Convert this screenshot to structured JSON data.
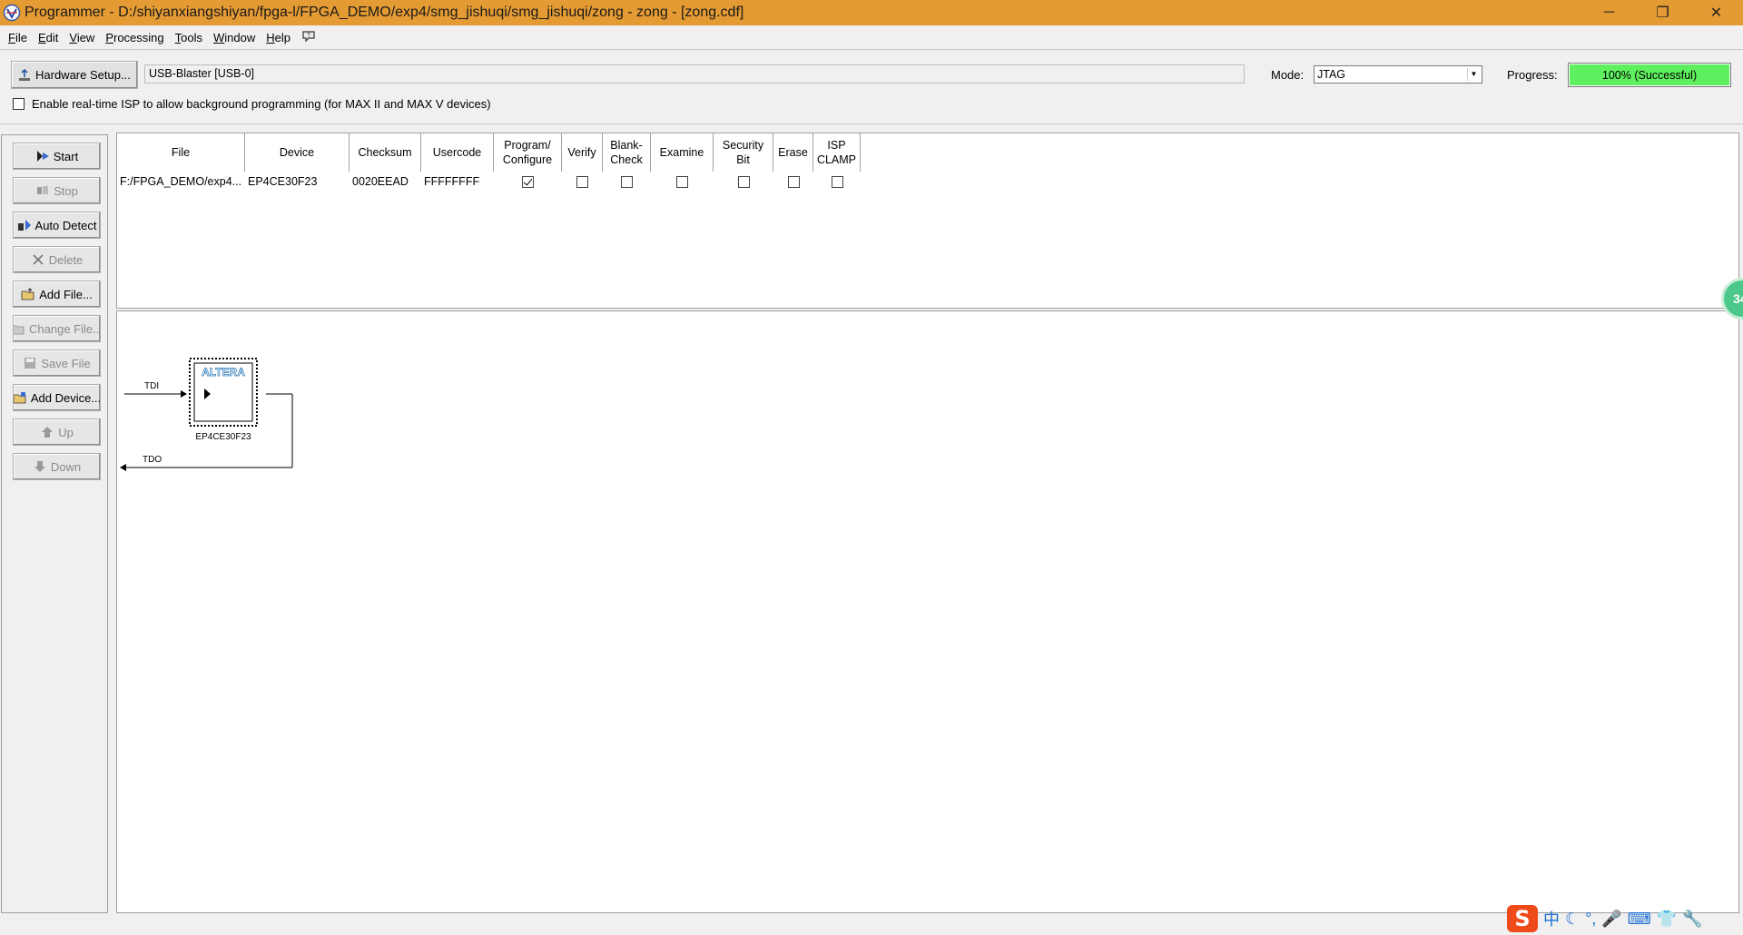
{
  "window": {
    "title": "Programmer - D:/shiyanxiangshiyan/fpga-l/FPGA_DEMO/exp4/smg_jishuqi/smg_jishuqi/zong - zong - [zong.cdf]",
    "minimize": "─",
    "maximize": "❐",
    "close": "✕"
  },
  "menu": [
    {
      "key": "F",
      "rest": "ile"
    },
    {
      "key": "E",
      "rest": "dit"
    },
    {
      "key": "V",
      "rest": "iew"
    },
    {
      "key": "P",
      "rest": "rocessing"
    },
    {
      "key": "T",
      "rest": "ools"
    },
    {
      "key": "W",
      "rest": "indow"
    },
    {
      "key": "H",
      "rest": "elp"
    }
  ],
  "toolbar": {
    "hardware_setup_label": "Hardware Setup...",
    "hardware_value": "USB-Blaster [USB-0]",
    "mode_label": "Mode:",
    "mode_value": "JTAG",
    "progress_label": "Progress:",
    "progress_text": "100% (Successful)",
    "progress_fraction": 1.0,
    "progress_color": "#5ff05f",
    "isp_label": "Enable real-time ISP to allow background programming (for MAX II and MAX V devices)",
    "isp_checked": false
  },
  "side_buttons": [
    {
      "label": "Start",
      "icon": "start-icon",
      "enabled": true
    },
    {
      "label": "Stop",
      "icon": "stop-icon",
      "enabled": false
    },
    {
      "label": "Auto Detect",
      "icon": "auto-detect-icon",
      "enabled": true
    },
    {
      "label": "Delete",
      "icon": "delete-icon",
      "enabled": false
    },
    {
      "label": "Add File...",
      "icon": "add-file-icon",
      "enabled": true
    },
    {
      "label": "Change File...",
      "icon": "change-file-icon",
      "enabled": false
    },
    {
      "label": "Save File",
      "icon": "save-file-icon",
      "enabled": false
    },
    {
      "label": "Add Device...",
      "icon": "add-device-icon",
      "enabled": true
    },
    {
      "label": "Up",
      "icon": "up-arrow-icon",
      "enabled": false
    },
    {
      "label": "Down",
      "icon": "down-arrow-icon",
      "enabled": false
    }
  ],
  "table": {
    "headers": [
      "File",
      "Device",
      "Checksum",
      "Usercode",
      "Program/\nConfigure",
      "Verify",
      "Blank-\nCheck",
      "Examine",
      "Security\nBit",
      "Erase",
      "ISP\nCLAMP"
    ],
    "rows": [
      {
        "file": "F:/FPGA_DEMO/exp4...",
        "device": "EP4CE30F23",
        "checksum": "0020EEAD",
        "usercode": "FFFFFFFF",
        "program_configure": true,
        "verify": false,
        "blank_check": false,
        "examine": false,
        "security_bit": false,
        "erase": false,
        "isp_clamp": false
      }
    ]
  },
  "chain": {
    "tdi": "TDI",
    "tdo": "TDO",
    "device_name": "EP4CE30F23",
    "logo_text": "ALTERA"
  },
  "badge": "34",
  "tray": {
    "ime_logo": "S",
    "items": [
      "中",
      "☾",
      "°,",
      "🎤",
      "⌨",
      "👕",
      "🔧"
    ]
  }
}
